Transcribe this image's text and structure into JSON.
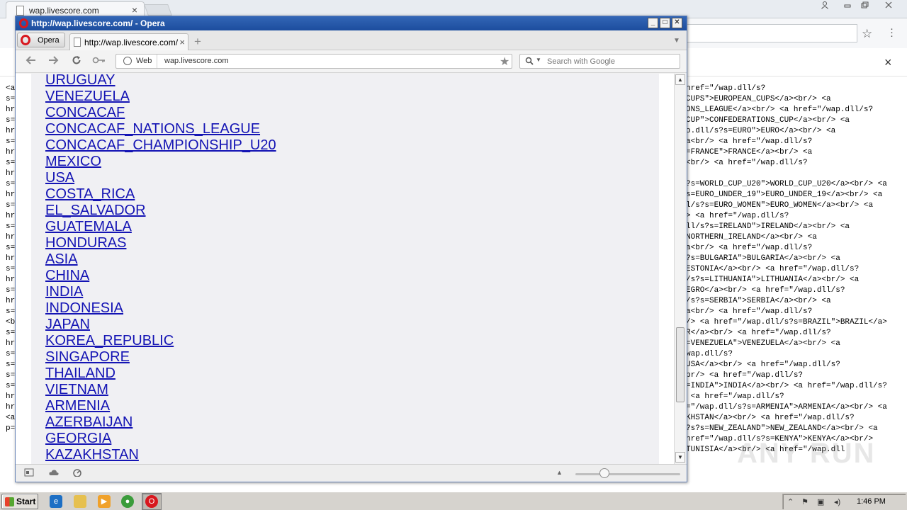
{
  "chrome": {
    "tab_title": "wap.livescore.com",
    "tab_close": "×",
    "omnibox_star": "☆",
    "infobar_close": "×",
    "source_left_lines": [
      "<a",
      "s=",
      "hr",
      "s=",
      "hr",
      "s=",
      "hr",
      "s=",
      "hr",
      "s=",
      "hr",
      "s=",
      "hr",
      "s=",
      "hr",
      "s=",
      "hr",
      "s=",
      "hr",
      "s=",
      "hr",
      "s=",
      "<b",
      "s=",
      "hr",
      "s=",
      "s=",
      "s=",
      "s=",
      "hr",
      "hr",
      "<a",
      "p="
    ],
    "source_right_lines": [
      "href=\"/wap.dll/s?",
      "CUPS\">EUROPEAN_CUPS</a><br/> <a",
      "ONS_LEAGUE</a><br/> <a href=\"/wap.dll/s?",
      "CUP\">CONFEDERATIONS_CUP</a><br/> <a",
      "o.dll/s?s=EURO\">EURO</a><br/> <a",
      "a<br/> <a href=\"/wap.dll/s?",
      "=FRANCE\">FRANCE</a><br/> <a",
      "<br/> <a href=\"/wap.dll/s?",
      "",
      "?s=WORLD_CUP_U20\">WORLD_CUP_U20</a><br/> <a",
      "s=EURO_UNDER_19\">EURO_UNDER_19</a><br/> <a",
      "l/s?s=EURO_WOMEN\">EURO_WOMEN</a><br/> <a",
      "> <a href=\"/wap.dll/s?",
      "ll/s?s=IRELAND\">IRELAND</a><br/> <a",
      "NORTHERN_IRELAND</a><br/> <a",
      "a<br/> <a href=\"/wap.dll/s?",
      "?s=BULGARIA\">BULGARIA</a><br/> <a",
      "ESTONIA</a><br/> <a href=\"/wap.dll/s?",
      "/s?s=LITHUANIA\">LITHUANIA</a><br/> <a",
      "EGRO</a><br/> <a href=\"/wap.dll/s?",
      "/s?s=SERBIA\">SERBIA</a><br/> <a",
      "a<br/> <a href=\"/wap.dll/s?",
      "/> <a href=\"/wap.dll/s?s=BRAZIL\">BRAZIL</a>",
      "R</a><br/> <a href=\"/wap.dll/s?",
      "=VENEZUELA\">VENEZUELA</a><br/> <a",
      "wap.dll/s?",
      "USA</a><br/> <a href=\"/wap.dll/s?",
      "br/> <a href=\"/wap.dll/s?",
      "=INDIA\">INDIA</a><br/> <a href=\"/wap.dll/s?",
      " <a href=\"/wap.dll/s?",
      "=\"/wap.dll/s?s=ARMENIA\">ARMENIA</a><br/> <a",
      "KHSTAN</a><br/> <a href=\"/wap.dll/s?",
      "?s?s=NEW_ZEALAND\">NEW_ZEALAND</a><br/> <a",
      "href=\"/wap.dll/s?s=KENYA\">KENYA</a><br/>",
      "TUNISIA</a><br/> <a href=\"/wap.dll"
    ],
    "watermark": "ANY RUN"
  },
  "opera": {
    "window_title": "http://wap.livescore.com/ - Opera",
    "menu_button": "Opera",
    "tab_title": "http://wap.livescore.com/",
    "tab_close": "×",
    "new_tab": "+",
    "address_prefix": "Web",
    "address_url": "wap.livescore.com",
    "search_placeholder": "Search with Google",
    "countries": [
      "URUGUAY",
      "VENEZUELA",
      "CONCACAF",
      "CONCACAF_NATIONS_LEAGUE",
      "CONCACAF_CHAMPIONSHIP_U20",
      "MEXICO",
      "USA",
      "COSTA_RICA",
      "EL_SALVADOR",
      "GUATEMALA",
      "HONDURAS",
      "ASIA",
      "CHINA",
      "INDIA",
      "INDONESIA",
      "JAPAN",
      "KOREA_REPUBLIC",
      "SINGAPORE",
      "THAILAND",
      "VIETNAM",
      "ARMENIA",
      "AZERBAIJAN",
      "GEORGIA",
      "KAZAKHSTAN"
    ],
    "scroll_position": 0.83
  },
  "taskbar": {
    "start_label": "Start",
    "clock": "1:46 PM"
  },
  "colors": {
    "link": "#1414b4",
    "titlebar": "#1c4d9e",
    "opera_red": "#d8171e"
  }
}
